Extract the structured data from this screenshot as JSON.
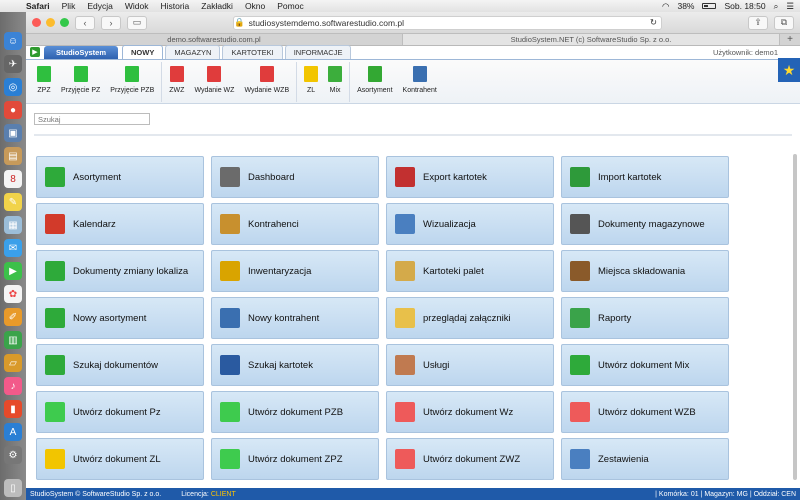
{
  "os_menu": {
    "app": "Safari",
    "items": [
      "Plik",
      "Edycja",
      "Widok",
      "Historia",
      "Zakładki",
      "Okno",
      "Pomoc"
    ],
    "battery": "38%",
    "clock": "Sob. 18:50"
  },
  "browser": {
    "url": "studiosystemdemo.softwarestudio.com.pl",
    "tabs": [
      "demo.softwarestudio.com.pl",
      "StudioSystem.NET (c) SoftwareStudio Sp. z o.o."
    ]
  },
  "app": {
    "brand": "StudioSystem",
    "nav_tabs": [
      "NOWY",
      "MAGAZYN",
      "KARTOTEKI",
      "INFORMACJE"
    ],
    "user_label": "Użytkownik: demo1"
  },
  "ribbon": [
    {
      "label": "ZPZ",
      "color": "#2fbf3f"
    },
    {
      "label": "Przyjęcie PZ",
      "color": "#2fbf3f"
    },
    {
      "label": "Przyjęcie PZB",
      "color": "#2fbf3f"
    },
    {
      "label": "ZWZ",
      "color": "#e03c3c"
    },
    {
      "label": "Wydanie WZ",
      "color": "#e03c3c"
    },
    {
      "label": "Wydanie WZB",
      "color": "#e03c3c"
    },
    {
      "label": "ZL",
      "color": "#f2c500"
    },
    {
      "label": "Mix",
      "color": "#3cae3c"
    },
    {
      "label": "Asortyment",
      "color": "#33a833"
    },
    {
      "label": "Kontrahent",
      "color": "#3a6fb0"
    }
  ],
  "search": {
    "placeholder": "Szukaj"
  },
  "tiles": [
    {
      "label": "Asortyment",
      "icon": "product-icon",
      "color": "#2eaa3a"
    },
    {
      "label": "Dashboard",
      "icon": "dashboard-icon",
      "color": "#6b6b6b"
    },
    {
      "label": "Export kartotek",
      "icon": "export-icon",
      "color": "#c23030"
    },
    {
      "label": "Import kartotek",
      "icon": "import-icon",
      "color": "#2e9a3a"
    },
    {
      "label": "Kalendarz",
      "icon": "calendar-icon",
      "color": "#d23a2a"
    },
    {
      "label": "Kontrahenci",
      "icon": "contractors-icon",
      "color": "#c8902e"
    },
    {
      "label": "Wizualizacja",
      "icon": "visualization-icon",
      "color": "#4a7fc0"
    },
    {
      "label": "Dokumenty magazynowe",
      "icon": "documents-icon",
      "color": "#555555"
    },
    {
      "label": "Dokumenty zmiany lokaliza",
      "icon": "location-change-icon",
      "color": "#2eaa3a"
    },
    {
      "label": "Inwentaryzacja",
      "icon": "inventory-icon",
      "color": "#d9a400"
    },
    {
      "label": "Kartoteki palet",
      "icon": "pallet-icon",
      "color": "#d4aa4a"
    },
    {
      "label": "Miejsca składowania",
      "icon": "shelf-icon",
      "color": "#8a5a2a"
    },
    {
      "label": "Nowy asortyment",
      "icon": "new-product-icon",
      "color": "#2eaa3a"
    },
    {
      "label": "Nowy kontrahent",
      "icon": "new-contractor-icon",
      "color": "#3a6fb0"
    },
    {
      "label": "przeglądaj załączniki",
      "icon": "folder-icon",
      "color": "#e8c04a"
    },
    {
      "label": "Raporty",
      "icon": "reports-icon",
      "color": "#3aa34a"
    },
    {
      "label": "Szukaj dokumentów",
      "icon": "search-documents-icon",
      "color": "#2eaa3a"
    },
    {
      "label": "Szukaj kartotek",
      "icon": "search-cards-icon",
      "color": "#2a5aa0"
    },
    {
      "label": "Usługi",
      "icon": "services-icon",
      "color": "#c07a50"
    },
    {
      "label": "Utwórz dokument Mix",
      "icon": "mix-icon",
      "color": "#2eaa3a"
    },
    {
      "label": "Utwórz dokument Pz",
      "icon": "doc-pz-icon",
      "color": "#3ecb4e"
    },
    {
      "label": "Utwórz dokument PZB",
      "icon": "doc-pzb-icon",
      "color": "#3ecb4e"
    },
    {
      "label": "Utwórz dokument Wz",
      "icon": "doc-wz-icon",
      "color": "#ee5a5a"
    },
    {
      "label": "Utwórz dokument WZB",
      "icon": "doc-wzb-icon",
      "color": "#ee5a5a"
    },
    {
      "label": "Utwórz dokument ZL",
      "icon": "doc-zl-icon",
      "color": "#f2c500"
    },
    {
      "label": "Utwórz dokument ZPZ",
      "icon": "doc-zpz-icon",
      "color": "#3ecb4e"
    },
    {
      "label": "Utwórz dokument ZWZ",
      "icon": "doc-zwz-icon",
      "color": "#ee5a5a"
    },
    {
      "label": "Zestawienia",
      "icon": "table-icon",
      "color": "#4a7fc0"
    }
  ],
  "status": {
    "copyright": "StudioSystem © SoftwareStudio Sp. z o.o.",
    "license_label": "Licencja:",
    "license_value": "CLIENT",
    "right": "| Komórka: 01 | Magazyn: MG | Oddział: CEN"
  }
}
